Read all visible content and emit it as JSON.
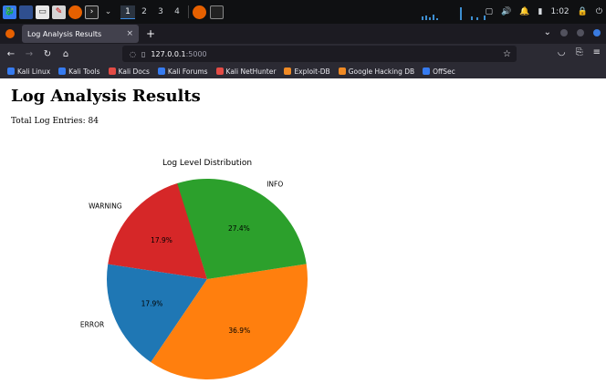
{
  "taskbar": {
    "workspaces": [
      "1",
      "2",
      "3",
      "4"
    ],
    "clock": "1:02"
  },
  "browser": {
    "tab_title": "Log Analysis Results",
    "tab_close": "×",
    "new_tab": "+",
    "url_host": "127.0.0.1",
    "url_port": ":5000",
    "bookmarks": [
      {
        "label": "Kali Linux",
        "color": "#367bf0"
      },
      {
        "label": "Kali Tools",
        "color": "#367bf0"
      },
      {
        "label": "Kali Docs",
        "color": "#e34b45"
      },
      {
        "label": "Kali Forums",
        "color": "#367bf0"
      },
      {
        "label": "Kali NetHunter",
        "color": "#e34b45"
      },
      {
        "label": "Exploit-DB",
        "color": "#f08a24"
      },
      {
        "label": "Google Hacking DB",
        "color": "#f08a24"
      },
      {
        "label": "OffSec",
        "color": "#367bf0"
      }
    ]
  },
  "page": {
    "title": "Log Analysis Results",
    "total_label": "Total Log Entries: 84"
  },
  "chart_data": {
    "type": "pie",
    "title": "Log Level Distribution",
    "slices": [
      {
        "label": "WARNING",
        "percent": 17.9,
        "value_label": "17.9%",
        "color": "#d62728"
      },
      {
        "label": "ERROR",
        "percent": 17.9,
        "value_label": "17.9%",
        "color": "#1f77b4"
      },
      {
        "label": "",
        "percent": 36.9,
        "value_label": "36.9%",
        "color": "#ff7f0e"
      },
      {
        "label": "INFO",
        "percent": 27.4,
        "value_label": "27.4%",
        "color": "#2ca02c"
      }
    ],
    "start_angle_deg": 107,
    "direction": "counterclockwise"
  }
}
